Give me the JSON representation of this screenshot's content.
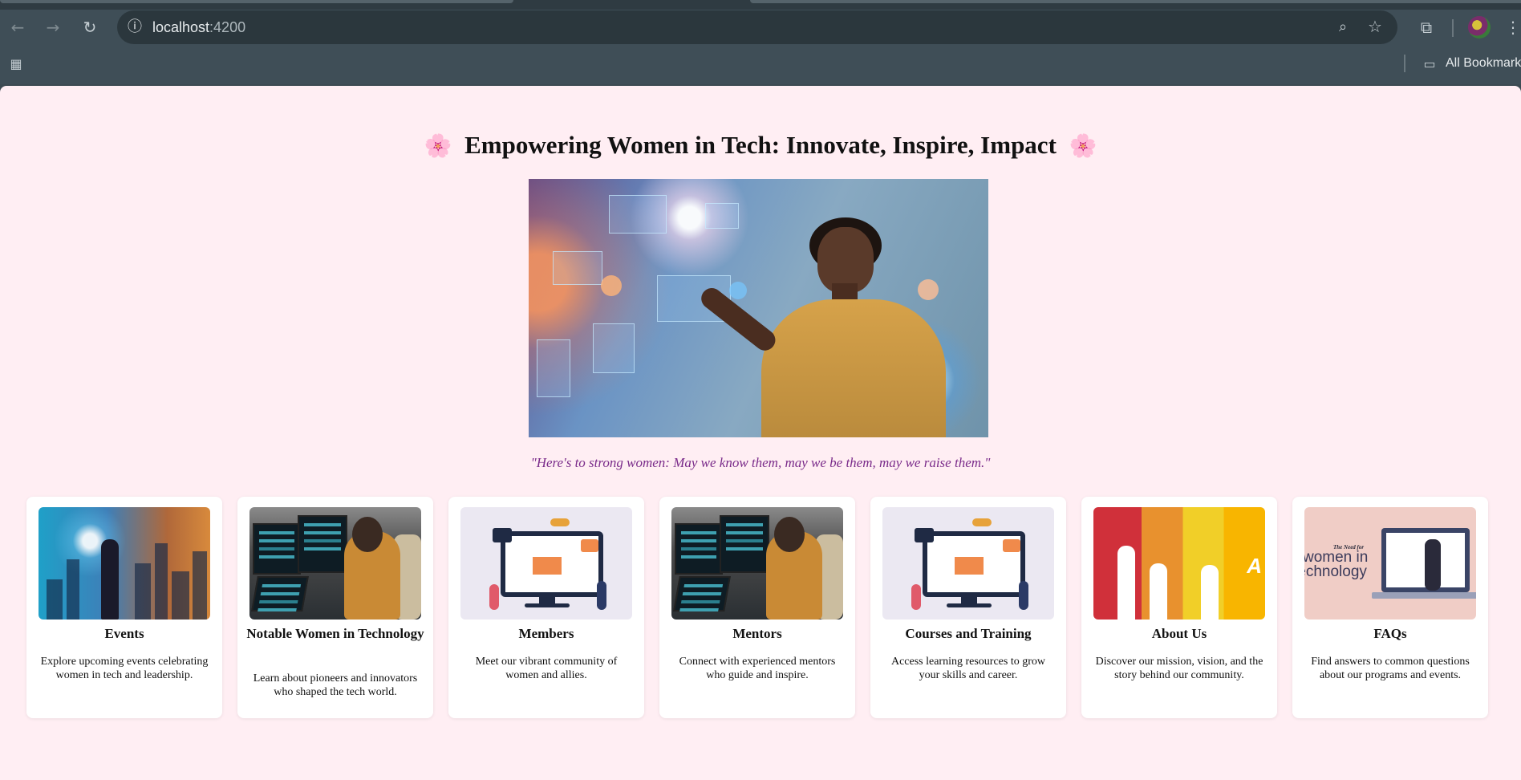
{
  "browser": {
    "url_host": "localhost",
    "url_port": ":4200",
    "bookmarks_label": "All Bookmarks",
    "icons": {
      "back": "back-arrow-icon",
      "forward": "forward-arrow-icon",
      "reload": "reload-icon",
      "site_info": "site-info-icon",
      "zoom": "zoom-icon",
      "bookmark_star": "star-icon",
      "extensions": "puzzle-piece-icon",
      "menu": "kebab-menu-icon",
      "apps": "apps-grid-icon",
      "folder": "folder-icon"
    }
  },
  "page": {
    "headline": "Empowering Women in Tech: Innovate, Inspire, Impact",
    "headline_decor": "🌸",
    "quote": "\"Here's to strong women: May we know them, may we be them, may we raise them.\"",
    "colors": {
      "background": "#ffeef3",
      "quote": "#7a2b8a",
      "card": "#ffffff"
    }
  },
  "cards": [
    {
      "title": "Events",
      "description": "Explore upcoming events celebrating women in tech and leadership."
    },
    {
      "title": "Notable Women in Technology",
      "description": "Learn about pioneers and innovators who shaped the tech world."
    },
    {
      "title": "Members",
      "description": "Meet our vibrant community of women and allies."
    },
    {
      "title": "Mentors",
      "description": "Connect with experienced mentors who guide and inspire."
    },
    {
      "title": "Courses and Training",
      "description": "Access learning resources to grow your skills and career."
    },
    {
      "title": "About Us",
      "description": "Discover our mission, vision, and the story behind our community."
    },
    {
      "title": "FAQs",
      "description": "Find answers to common questions about our programs and events."
    }
  ],
  "thumb_text": {
    "about_letter": "A",
    "faq_small": "The Need for",
    "faq_big_line1": "women in",
    "faq_big_line2": "technology"
  }
}
